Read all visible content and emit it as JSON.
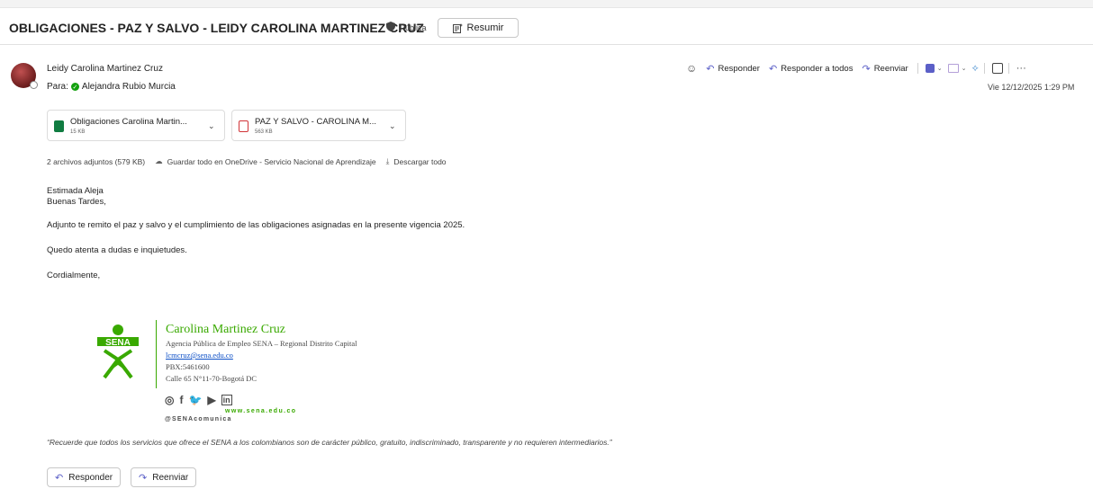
{
  "email": {
    "subject": "OBLIGACIONES - PAZ Y SALVO - LEIDY CAROLINA MARTINEZ CRUZ",
    "visibility": "Pública",
    "summarize_label": "Resumir",
    "sender": "Leidy Carolina Martinez Cruz",
    "to_label": "Para:",
    "recipient": "Alejandra Rubio Murcia",
    "date": "Vie 12/12/2025 1:29 PM"
  },
  "actions": {
    "reply": "Responder",
    "reply_all": "Responder a todos",
    "forward": "Reenviar"
  },
  "attachments": [
    {
      "name": "Obligaciones Carolina Martin...",
      "size": "15 KB",
      "icon": "excel-file-icon",
      "color": "#107c41"
    },
    {
      "name": "PAZ Y SALVO - CAROLINA M...",
      "size": "563 KB",
      "icon": "pdf-file-icon",
      "color": "#d13438"
    }
  ],
  "attachment_info": {
    "count": "2 archivos adjuntos (579 KB)",
    "save_onedrive": "Guardar todo en OneDrive - Servicio Nacional de Aprendizaje",
    "download_all": "Descargar todo"
  },
  "body": {
    "greeting1": "Estimada Aleja",
    "greeting2": "Buenas Tardes,",
    "p1": "Adjunto te remito el paz y salvo y el cumplimiento de las obligaciones asignadas en la presente vigencia 2025.",
    "p2": "Quedo atenta a dudas e inquietudes.",
    "closing": "Cordialmente,"
  },
  "signature": {
    "logo_text": "SENA",
    "name": "Carolina Martinez Cruz",
    "org": "Agencia Pública de Empleo SENA – Regional Distrito Capital",
    "email": "lcmcruz@sena.edu.co",
    "pbx": "PBX:5461600",
    "address": "Calle 65 N°11-70-Bogotá DC",
    "website": "www.sena.edu.co",
    "handle": "@SENAcomunica",
    "green": "#39a900"
  },
  "disclaimer": "“Recuerde que todos los servicios que ofrece el SENA a los colombianos son de carácter público, gratuito, indiscriminado, transparente y no requieren intermediarios.”",
  "footer": {
    "reply": "Responder",
    "forward": "Reenviar"
  }
}
